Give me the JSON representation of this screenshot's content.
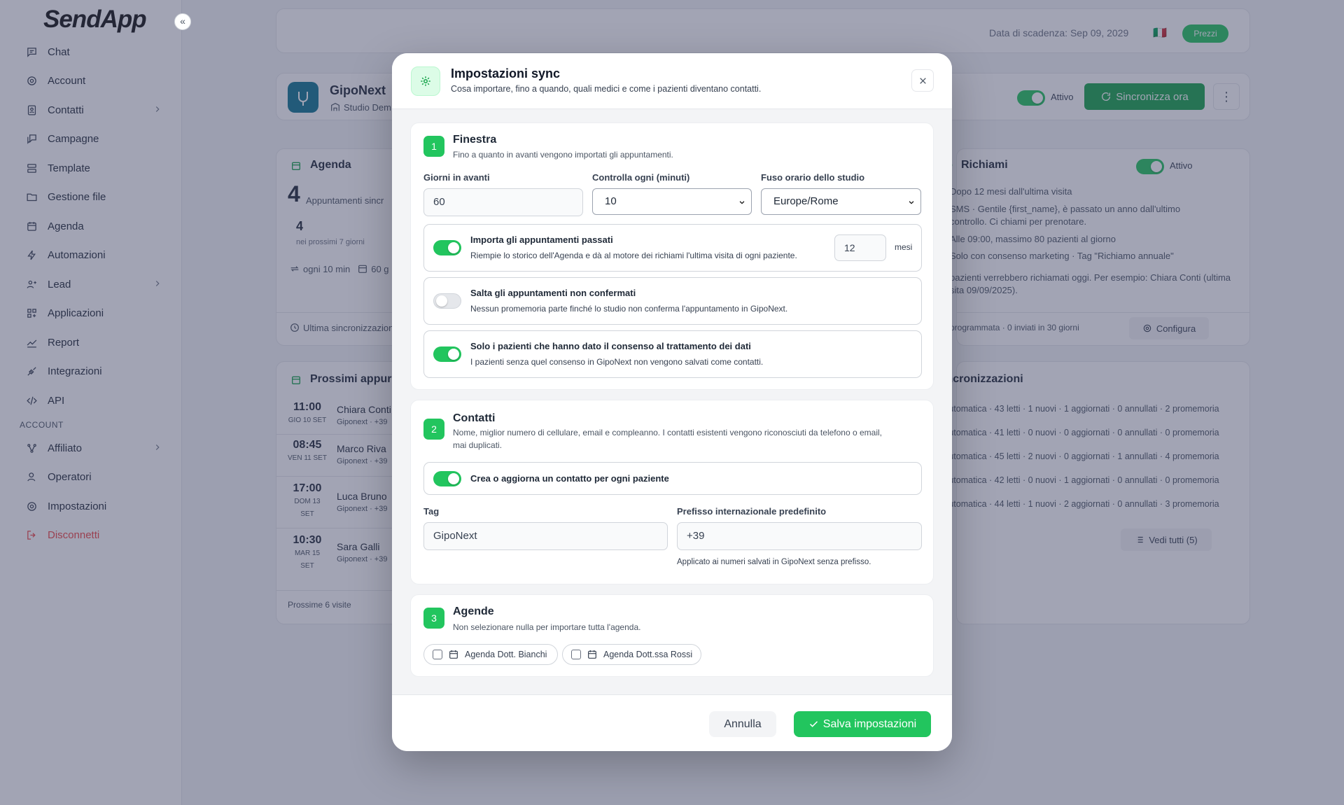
{
  "app": {
    "logo": "SendApp",
    "collapse_icon": "«"
  },
  "sidebar": {
    "items": [
      {
        "label": "Chat",
        "icon": "chat-icon"
      },
      {
        "label": "Account",
        "icon": "gear-icon"
      },
      {
        "label": "Contatti",
        "icon": "contacts-icon",
        "has_submenu": true
      },
      {
        "label": "Campagne",
        "icon": "campaign-icon"
      },
      {
        "label": "Template",
        "icon": "template-icon"
      },
      {
        "label": "Gestione file",
        "icon": "folder-icon"
      },
      {
        "label": "Agenda",
        "icon": "calendar-icon"
      },
      {
        "label": "Automazioni",
        "icon": "bolt-icon"
      },
      {
        "label": "Lead",
        "icon": "lead-icon",
        "has_submenu": true
      },
      {
        "label": "Applicazioni",
        "icon": "apps-icon"
      },
      {
        "label": "Report",
        "icon": "report-icon"
      },
      {
        "label": "Integrazioni",
        "icon": "integration-icon"
      },
      {
        "label": "API",
        "icon": "code-icon"
      }
    ],
    "section_label": "ACCOUNT",
    "account_items": [
      {
        "label": "Affiliato",
        "icon": "affiliate-icon",
        "has_submenu": true
      },
      {
        "label": "Operatori",
        "icon": "operators-icon"
      },
      {
        "label": "Impostazioni",
        "icon": "settings-icon"
      },
      {
        "label": "Disconnetti",
        "icon": "logout-icon",
        "danger": true
      }
    ]
  },
  "topbar": {
    "expiry": "Data di scadenza: Sep 09, 2029",
    "flag": "🇮🇹",
    "prices_button": "Prezzi"
  },
  "integration": {
    "name": "GipoNext",
    "studio": "Studio Dem",
    "active_label": "Attivo",
    "sync_button": "Sincronizza ora"
  },
  "agenda_card": {
    "title": "Agenda",
    "big_count": "4",
    "big_label": "Appuntamenti sincr",
    "next_count": "4",
    "next_label": "nei prossimi 7 giorni",
    "interval": "ogni 10 min",
    "window": "60 g",
    "last_sync": "Ultima sincronizzazion"
  },
  "recalls_card": {
    "title": "Richiami",
    "active_label": "Attivo",
    "lines": [
      "Dopo 12 mesi dall'ultima visita",
      "SMS · Gentile {first_name}, è passato un anno dall'ultimo",
      "controllo. Ci chiami per prenotare.",
      "Alle 09:00, massimo 80 pazienti al giorno",
      "Solo con consenso marketing · Tag \"Richiamo annuale\""
    ],
    "example_1": "pazienti verrebbero richiamati oggi. Per esempio: Chiara Conti (ultima",
    "example_2": "sita 09/09/2025).",
    "footer": "programmata · 0 inviati in 30 giorni",
    "configure_button": "Configura"
  },
  "upcoming_card": {
    "title": "Prossimi appur",
    "rows": [
      {
        "time": "11:00",
        "date": "GIO 10 SET",
        "date2": "",
        "name": "Chiara Conti",
        "sub": "Giponext · +39"
      },
      {
        "time": "08:45",
        "date": "VEN 11 SET",
        "date2": "",
        "name": "Marco Riva",
        "sub": "Giponext · +39"
      },
      {
        "time": "17:00",
        "date": "DOM 13",
        "date2": "SET",
        "name": "Luca Bruno",
        "sub": "Giponext · +39"
      },
      {
        "time": "10:30",
        "date": "MAR 15",
        "date2": "SET",
        "name": "Sara Galli",
        "sub": "Giponext · +39"
      }
    ],
    "footer": "Prossime 6 visite"
  },
  "syncs_card": {
    "title": "incronizzazioni",
    "rows": [
      "Automatica · 43 letti · 1 nuovi · 1 aggiornati · 0 annullati · 2 promemoria",
      "Automatica · 41 letti · 0 nuovi · 0 aggiornati · 0 annullati · 0 promemoria",
      "Automatica · 45 letti · 2 nuovi · 0 aggiornati · 1 annullati · 4 promemoria",
      "Automatica · 42 letti · 0 nuovi · 1 aggiornati · 0 annullati · 0 promemoria",
      "Automatica · 44 letti · 1 nuovi · 2 aggiornati · 0 annullati · 3 promemoria"
    ],
    "see_all_button": "Vedi tutti (5)"
  },
  "modal": {
    "title": "Impostazioni sync",
    "subtitle": "Cosa importare, fino a quando, quali medici e come i pazienti diventano contatti.",
    "section1": {
      "number": "1",
      "title": "Finestra",
      "subtitle": "Fino a quanto in avanti vengono importati gli appuntamenti.",
      "days_label": "Giorni in avanti",
      "days_value": "60",
      "check_label": "Controlla ogni (minuti)",
      "check_value": "10",
      "tz_label": "Fuso orario dello studio",
      "tz_value": "Europe/Rome",
      "opt_past_title": "Importa gli appuntamenti passati",
      "opt_past_sub": "Riempie lo storico dell'Agenda e dà al motore dei richiami l'ultima visita di ogni paziente.",
      "opt_past_on": true,
      "months_value": "12",
      "months_unit": "mesi",
      "opt_skip_title": "Salta gli appuntamenti non confermati",
      "opt_skip_sub": "Nessun promemoria parte finché lo studio non conferma l'appuntamento in GipoNext.",
      "opt_skip_on": false,
      "opt_consent_title": "Solo i pazienti che hanno dato il consenso al trattamento dei dati",
      "opt_consent_sub": "I pazienti senza quel consenso in GipoNext non vengono salvati come contatti.",
      "opt_consent_on": true
    },
    "section2": {
      "number": "2",
      "title": "Contatti",
      "subtitle_1": "Nome, miglior numero di cellulare, email e compleanno. I contatti esistenti vengono riconosciuti da telefono o email,",
      "subtitle_2": "mai duplicati.",
      "opt_create_title": "Crea o aggiorna un contatto per ogni paziente",
      "opt_create_on": true,
      "tag_label": "Tag",
      "tag_value": "GipoNext",
      "prefix_label": "Prefisso internazionale predefinito",
      "prefix_value": "+39",
      "prefix_help": "Applicato ai numeri salvati in GipoNext senza prefisso."
    },
    "section3": {
      "number": "3",
      "title": "Agende",
      "subtitle": "Non selezionare nulla per importare tutta l'agenda.",
      "agendas": [
        "Agenda Dott. Bianchi",
        "Agenda Dott.ssa Rossi"
      ]
    },
    "cancel_button": "Annulla",
    "save_button": "Salva impostazioni"
  },
  "colors": {
    "accent": "#22c55e",
    "danger": "#ef4444",
    "overlay": "#3a3e60"
  }
}
